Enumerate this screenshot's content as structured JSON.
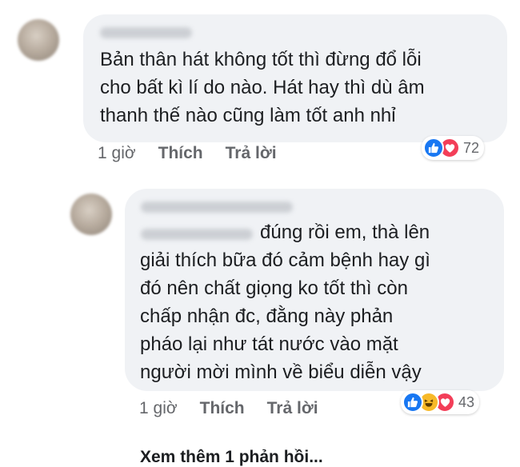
{
  "comments": [
    {
      "text": "Bản thân hát không tốt thì đừng đổ lỗi\ncho bất kì lí do nào. Hát hay thì dù âm\nthanh thế nào cũng làm tốt anh nhỉ",
      "time": "1 giờ",
      "like_label": "Thích",
      "reply_label": "Trả lời",
      "reactions": [
        "like-icon",
        "love-icon"
      ],
      "reaction_count": "72"
    },
    {
      "text_first": "đúng rồi em, thà lên",
      "text_rest": "giải thích bữa đó cảm bệnh hay gì\nđó nên chất giọng ko tốt thì còn\nchấp nhận đc, đằng này phản\npháo lại như tát nước vào mặt\nngười mời mình về biểu diễn vậy",
      "time": "1 giờ",
      "like_label": "Thích",
      "reply_label": "Trả lời",
      "reactions": [
        "like-icon",
        "haha-icon",
        "love-icon"
      ],
      "reaction_count": "43"
    }
  ],
  "view_more": "Xem thêm 1 phản hồi...",
  "colors": {
    "bubble": "#f0f2f5",
    "like": "#1877f2",
    "love": "#f33e58",
    "haha": "#f7b928",
    "meta": "#65676b"
  }
}
